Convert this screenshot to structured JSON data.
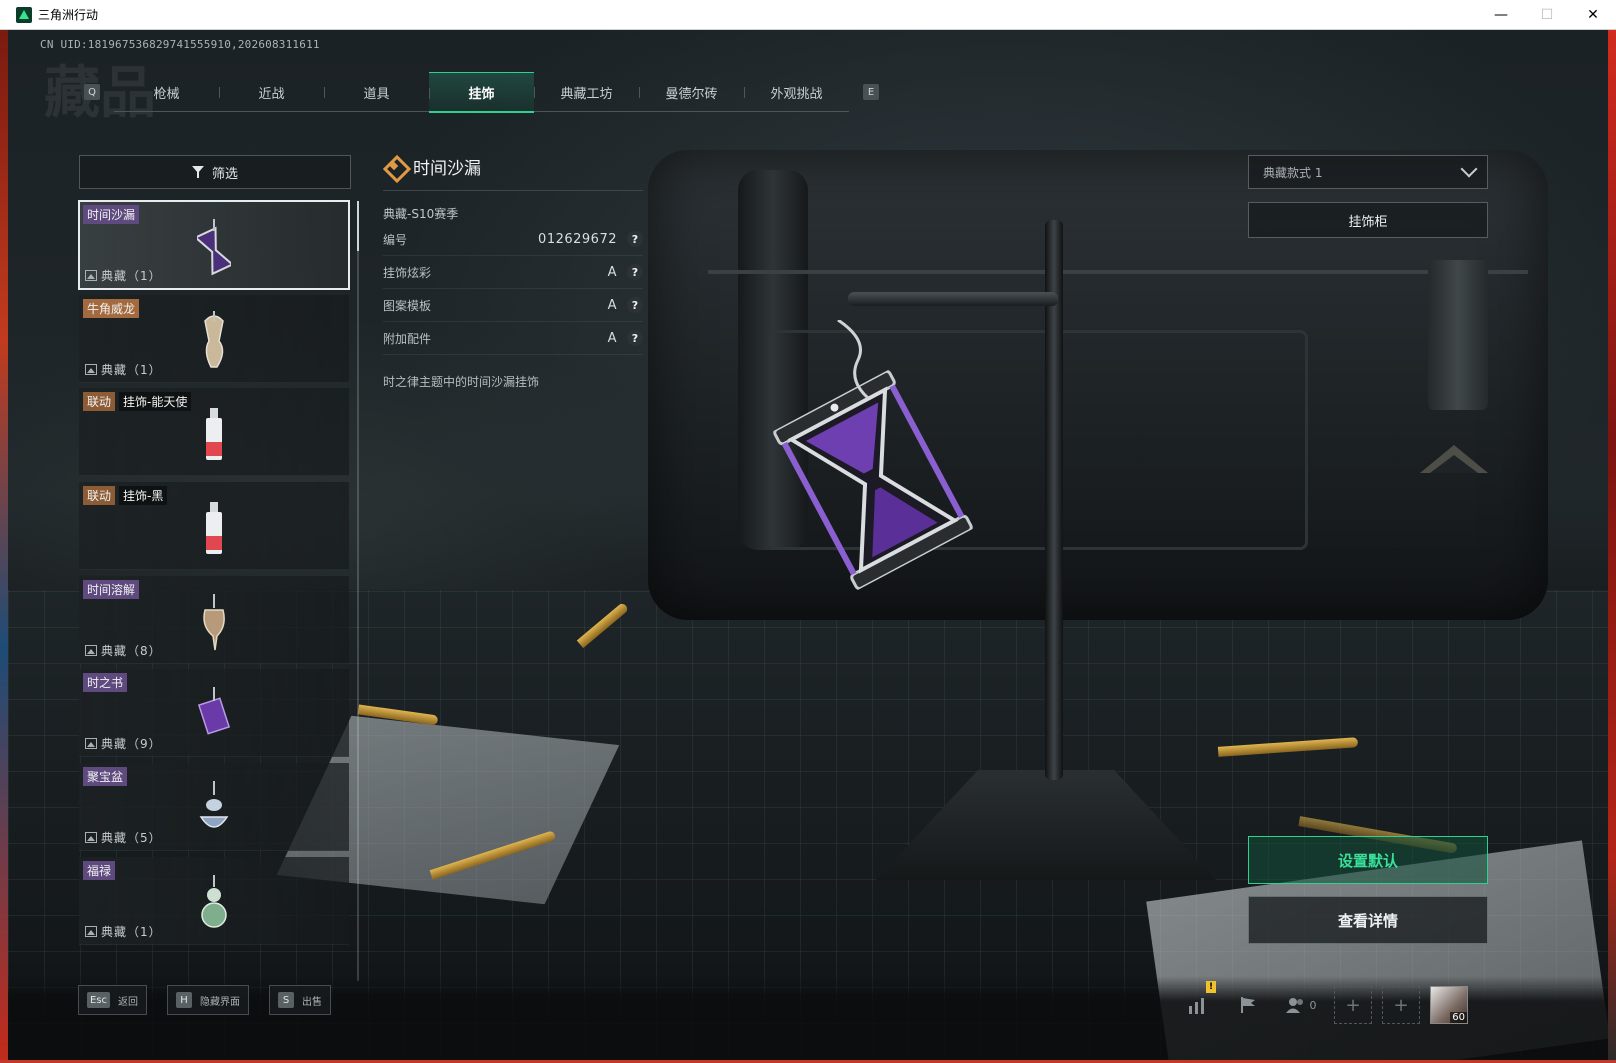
{
  "window": {
    "title": "三角洲行动",
    "controls": {
      "minimize": "—",
      "maximize": "☐",
      "close": "✕"
    }
  },
  "uid_text": "CN UID:181967536829741555910,202608311611",
  "page_ghost_title": "藏品",
  "tabs": {
    "prev_key": "Q",
    "next_key": "E",
    "items": [
      {
        "label": "枪械",
        "active": false
      },
      {
        "label": "近战",
        "active": false
      },
      {
        "label": "道具",
        "active": false
      },
      {
        "label": "挂饰",
        "active": true
      },
      {
        "label": "典藏工坊",
        "active": false
      },
      {
        "label": "曼德尔砖",
        "active": false
      },
      {
        "label": "外观挑战",
        "active": false
      }
    ]
  },
  "filter": {
    "label": "筛选",
    "icon": "filter-icon"
  },
  "items": [
    {
      "tags": [
        {
          "text": "时间沙漏",
          "style": "purple"
        }
      ],
      "footer": "典藏（1）",
      "selected": true,
      "thumb": "hourglass"
    },
    {
      "tags": [
        {
          "text": "牛角威龙",
          "style": "orange"
        }
      ],
      "footer": "典藏（1）",
      "selected": false,
      "thumb": "horn"
    },
    {
      "tags": [
        {
          "text": "联动",
          "style": "coll"
        },
        {
          "text": "挂饰-能天使",
          "style": "dark"
        }
      ],
      "footer": "",
      "selected": false,
      "thumb": "bottle-red"
    },
    {
      "tags": [
        {
          "text": "联动",
          "style": "coll"
        },
        {
          "text": "挂饰-黑",
          "style": "dark"
        }
      ],
      "footer": "",
      "selected": false,
      "thumb": "bottle-red"
    },
    {
      "tags": [
        {
          "text": "时间溶解",
          "style": "purple"
        }
      ],
      "footer": "典藏（8）",
      "selected": false,
      "thumb": "melt"
    },
    {
      "tags": [
        {
          "text": "时之书",
          "style": "purple"
        }
      ],
      "footer": "典藏（9）",
      "selected": false,
      "thumb": "book"
    },
    {
      "tags": [
        {
          "text": "聚宝盆",
          "style": "purple"
        }
      ],
      "footer": "典藏（5）",
      "selected": false,
      "thumb": "bowl"
    },
    {
      "tags": [
        {
          "text": "福禄",
          "style": "purple"
        }
      ],
      "footer": "典藏（1）",
      "selected": false,
      "thumb": "gourd"
    }
  ],
  "detail": {
    "title": "时间沙漏",
    "season": "典藏-S10赛季",
    "rows": [
      {
        "label": "编号",
        "value": "012629672"
      },
      {
        "label": "挂饰炫彩",
        "value": "A"
      },
      {
        "label": "图案模板",
        "value": "A"
      },
      {
        "label": "附加配件",
        "value": "A"
      }
    ],
    "help_glyph": "?",
    "description": "时之律主题中的时间沙漏挂饰"
  },
  "right_panel": {
    "style_select": "典藏款式 1",
    "cabinet_button": "挂饰柜",
    "default_button": "设置默认",
    "detail_button": "查看详情"
  },
  "bottom_bar": {
    "keys": [
      {
        "key": "Esc",
        "label": "返回"
      },
      {
        "key": "H",
        "label": "隐藏界面"
      },
      {
        "key": "S",
        "label": "出售"
      }
    ],
    "friends_count": "0",
    "warn_badge": "!",
    "slot_glyph": "+",
    "avatar_level": "60"
  },
  "colors": {
    "accent": "#2bd48e",
    "title_icon": "#e09a43",
    "tag_purple": "#5e4a7e",
    "tag_orange": "#a46a3f"
  }
}
